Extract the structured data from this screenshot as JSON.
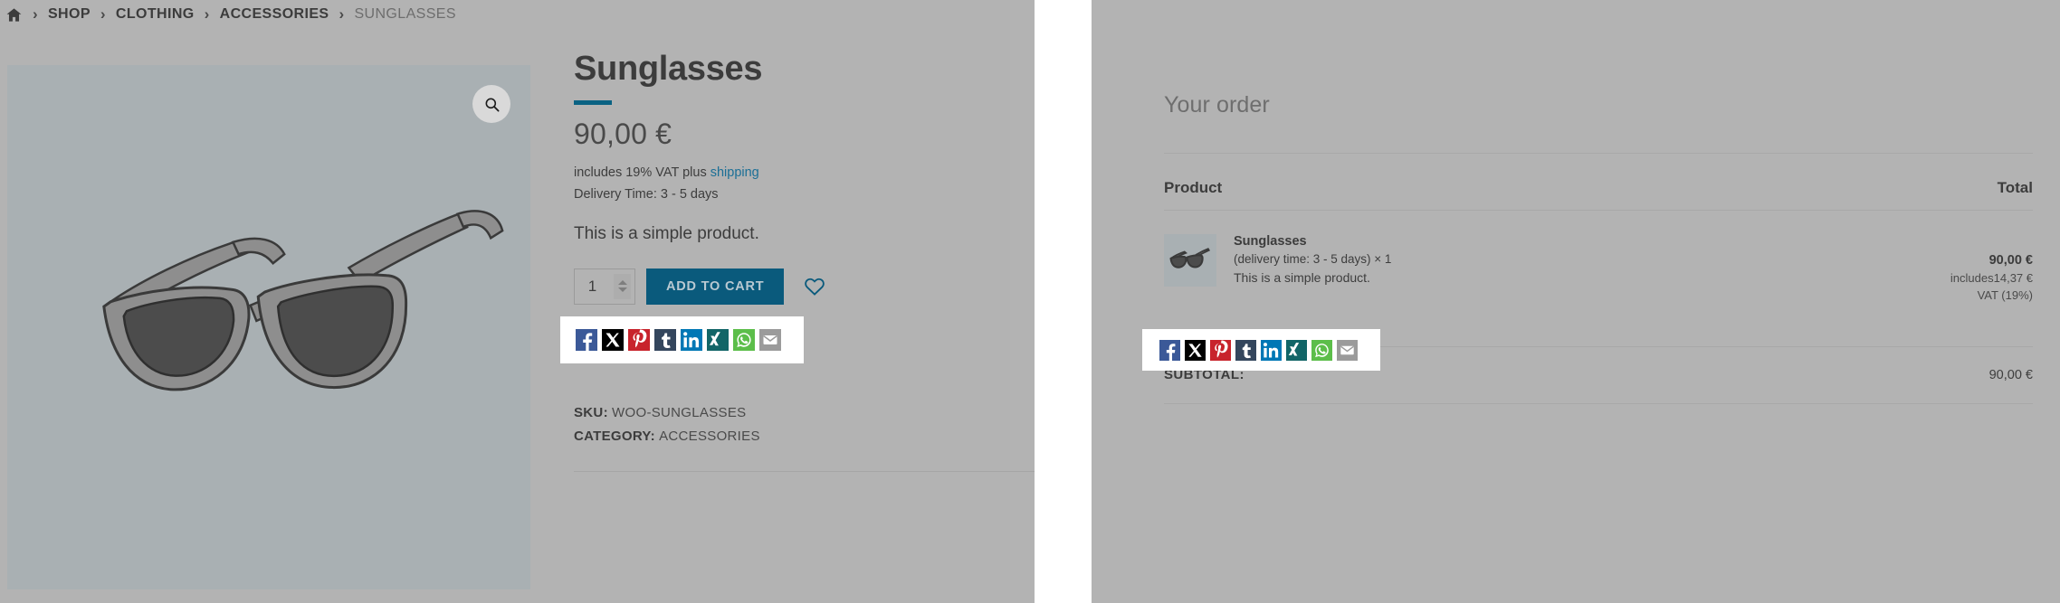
{
  "breadcrumb": {
    "home_icon": "home-icon",
    "separator": "›",
    "items": [
      {
        "label": "SHOP",
        "current": false
      },
      {
        "label": "CLOTHING",
        "current": false
      },
      {
        "label": "ACCESSORIES",
        "current": false
      },
      {
        "label": "SUNGLASSES",
        "current": true
      }
    ]
  },
  "product": {
    "title": "Sunglasses",
    "price": "90,00 €",
    "tax_prefix": "includes 19% VAT plus ",
    "tax_link": "shipping",
    "delivery": "Delivery Time: 3 - 5 days",
    "short_description": "This is a simple product.",
    "quantity": "1",
    "add_to_cart_label": "ADD TO CART",
    "wishlist_icon": "heart-icon",
    "zoom_icon": "magnifier-icon",
    "image_alt": "sunglasses-illustration",
    "sku_label": "SKU:",
    "sku_value": "WOO-SUNGLASSES",
    "category_label": "CATEGORY:",
    "category_value": "ACCESSORIES"
  },
  "share": {
    "buttons": [
      {
        "name": "facebook",
        "glyph": "f",
        "color": "#3b5998"
      },
      {
        "name": "x-twitter",
        "glyph": "X",
        "color": "#000000"
      },
      {
        "name": "pinterest",
        "glyph": "P",
        "color": "#c8232c"
      },
      {
        "name": "tumblr",
        "glyph": "t",
        "color": "#34465d"
      },
      {
        "name": "linkedin",
        "glyph": "in",
        "color": "#0077b5"
      },
      {
        "name": "xing",
        "glyph": "X",
        "color": "#126567"
      },
      {
        "name": "whatsapp",
        "glyph": "W",
        "color": "#5cbe4a"
      },
      {
        "name": "email",
        "glyph": "M",
        "color": "#9b9b9b"
      }
    ]
  },
  "order": {
    "heading": "Your order",
    "col_product": "Product",
    "col_total": "Total",
    "item": {
      "name": "Sunglasses",
      "variant": "(delivery time: 3 - 5 days) × 1",
      "quantity_suffix": "× 1",
      "description": "This is a simple product.",
      "total": "90,00 €",
      "vat_line1": "includes14,37 €",
      "vat_line2": "VAT (19%)",
      "thumb_alt": "sunglasses-thumbnail"
    },
    "subtotal_label": "SUBTOTAL:",
    "subtotal_value": "90,00 €"
  },
  "theme": {
    "page_bg": "#b3b3b3",
    "accent": "#0a6283",
    "button_bg": "#0a5a7c",
    "link": "#1b6f96"
  }
}
